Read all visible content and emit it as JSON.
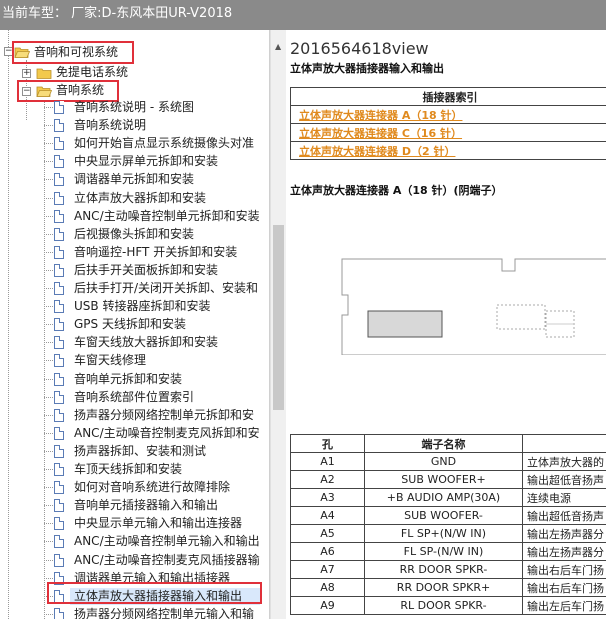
{
  "topbar": {
    "label": "当前车型：  厂家:D-东风本田UR-V2018"
  },
  "tree": {
    "group_audio_visual": "音响和可视系统",
    "group_handsfree": "免提电话系统",
    "group_audio": "音响系统",
    "items": [
      "音响系统说明 - 系统图",
      "音响系统说明",
      "如何开始盲点显示系统摄像头对准",
      "中央显示屏单元拆卸和安装",
      "调谐器单元拆卸和安装",
      "立体声放大器拆卸和安装",
      "ANC/主动噪音控制单元拆卸和安装",
      "后视摄像头拆卸和安装",
      "音响遥控-HFT 开关拆卸和安装",
      "后扶手开关面板拆卸和安装",
      "后扶手打开/关闭开关拆卸、安装和",
      "USB 转接器座拆卸和安装",
      "GPS 天线拆卸和安装",
      "车窗天线放大器拆卸和安装",
      "车窗天线修理",
      "音响单元拆卸和安装",
      "音响系统部件位置索引",
      "扬声器分频网络控制单元拆卸和安",
      "ANC/主动噪音控制麦克风拆卸和安",
      "扬声器拆卸、安装和测试",
      "车顶天线拆卸和安装",
      "如何对音响系统进行故障排除",
      "音响单元插接器输入和输出",
      "中央显示单元输入和输出连接器",
      "ANC/主动噪音控制单元输入和输出",
      "ANC/主动噪音控制麦克风插接器输",
      "调谐器单元输入和输出插接器",
      "立体声放大器插接器输入和输出",
      "扬声器分频网络控制单元输入和输"
    ]
  },
  "document": {
    "title": "2016564618view",
    "subtitle": "立体声放大器插接器输入和输出",
    "index_header": "插接器索引",
    "index_links": [
      "立体声放大器连接器 A（18 针）",
      "立体声放大器连接器 C（16 针）",
      "立体声放大器连接器 D（2 针）"
    ],
    "connector_heading": "立体声放大器连接器 A（18 针）(阴端子）",
    "pin_table": {
      "headers": [
        "孔",
        "端子名称",
        ""
      ],
      "rows": [
        [
          "A1",
          "GND",
          "立体声放大器的"
        ],
        [
          "A2",
          "SUB WOOFER+",
          "输出超低音扬声"
        ],
        [
          "A3",
          "+B AUDIO AMP(30A)",
          "连续电源"
        ],
        [
          "A4",
          "SUB WOOFER-",
          "输出超低音扬声"
        ],
        [
          "A5",
          "FL SP+(N/W IN)",
          "输出左扬声器分"
        ],
        [
          "A6",
          "FL SP-(N/W IN)",
          "输出左扬声器分"
        ],
        [
          "A7",
          "RR DOOR SPKR-",
          "输出右后车门扬"
        ],
        [
          "A8",
          "RR DOOR SPKR+",
          "输出右后车门扬"
        ],
        [
          "A9",
          "RL DOOR SPKR-",
          "输出左后车门扬"
        ]
      ]
    }
  },
  "colors": {
    "highlight": "#e0303a",
    "link": "#e08a1e",
    "topbar": "#8a8a8a",
    "folder": "#f2c94c"
  }
}
